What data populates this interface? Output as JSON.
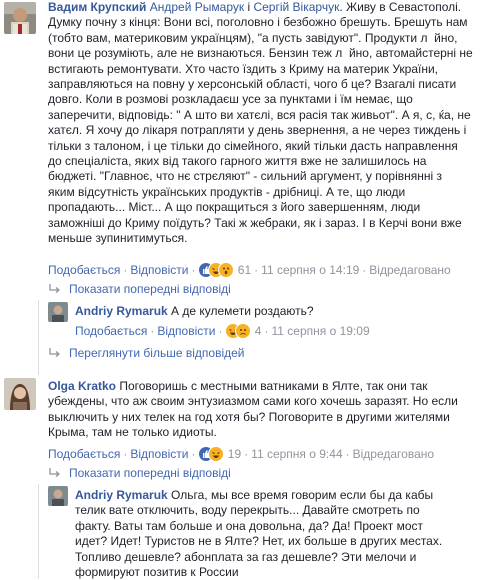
{
  "c1": {
    "author": "Вадим Крупский",
    "tags_prefix": " ",
    "tag1": "Андрей Рымарук",
    "tag_join": " і ",
    "tag2": "Сергій Вікарчук",
    "lines": [
      ". Живу в Севастополі.",
      "Думку почну з кінця: Вони всі, поголовно і безбожно брешуть. Брешуть нам",
      "(тобто вам, материковим українцям), \"а пусть завідуют\". Продукти л  йно,",
      "вони це розуміють, але не визнаються. Бензин теж л  йно, автомайстерні не",
      "встигають ремонтувати. Хто часто їздить з Криму на материк України,",
      "заправляються на повну у херсонській області, чого б це? Взагалі писати",
      "довго. Коли в розмові розкладаєш усе за пунктами і їм немає, що",
      "заперечити, відповідь: \" А што ви хатєлі, вся расія так живьот\". А я, с, ќа, не",
      "хатєл. Я хочу до лікаря потрапляти у день звернення, а не через тиждень і",
      "тільки з талоном, і це тільки до сімейного, який тільки дасть направлення",
      "до спеціаліста, яких від такого гарного життя вже не залишилось на",
      "бюджеті. \"Главноє, что нє стрєляют\" - сильний аргумент, у порівнянні з",
      "яким відсутність українських продуктів - дрібниці. А те, що люди",
      "пропадають... Міст... А що покращиться з його завершенням, люди",
      "заможніші до Криму поїдуть? Такі ж жебраки, як і зараз. І в Керчі вони вже",
      "меньше зупинитимуться."
    ],
    "like": "Подобається",
    "reply": "Відповісти",
    "reactions": "61",
    "time": "11 серпня о 14:19",
    "edited": "Відредаговано",
    "show_prev": "Показати попередні відповіді"
  },
  "r1": {
    "author": "Andriy Rymaruk",
    "text": " А де кулемети роздають?",
    "like": "Подобається",
    "reply": "Відповісти",
    "reactions": "4",
    "time": "11 серпня о 19:09",
    "more": "Переглянути більше відповідей"
  },
  "c2": {
    "author": "Olga Kratko",
    "lines": [
      " Поговоришь с местными ватниками в Ялте, так они так",
      "убеждены, что аж своим энтузиазмом сами кого хочешь заразят. Но если",
      "выключить у них телек на год хотя бы? Поговорите в другими жителями",
      "Крыма, там не только идиоты."
    ],
    "like": "Подобається",
    "reply": "Відповісти",
    "reactions": "19",
    "time": "11 серпня о 9:44",
    "edited": "Відредаговано",
    "show_prev": "Показати попередні відповіді"
  },
  "r2": {
    "author": "Andriy Rymaruk",
    "lines": [
      " Ольга, мы все время говорим если бы да кабы",
      "телик вате отключить, воду перекрыть... Давайте смотреть по",
      "факту. Ваты там больше и она довольна, да? Да! Проект мост",
      "идет? Идет! Туристов не в Ялте? Нет, их больше в других местах.",
      "Топливо дешевле? абонплата за газ дешевле? Эти мелочи и",
      "формируют позитив к России"
    ]
  },
  "colors": {
    "link": "#365899",
    "action": "#4267b2",
    "meta": "#90949c",
    "text": "#1d2129"
  }
}
